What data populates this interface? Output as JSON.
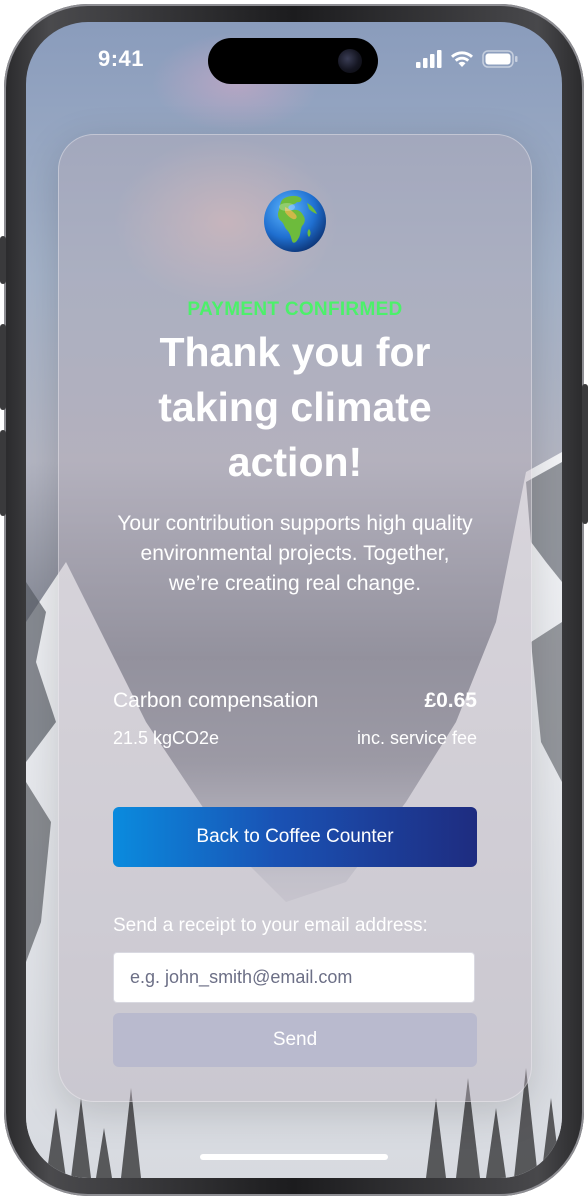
{
  "status_bar": {
    "time": "9:41"
  },
  "card": {
    "icon": "globe-europe-africa-icon",
    "status_label": "PAYMENT CONFIRMED",
    "status_color": "#4cf06a",
    "headline": "Thank you for taking climate action!",
    "subtext": "Your contribution supports high quality environmental projects. Together, we’re creating real change.",
    "summary": {
      "label": "Carbon compensation",
      "amount": "£0.65",
      "emissions": "21.5 kgCO2e",
      "fee_note": "inc. service fee"
    },
    "back_button_label": "Back to Coffee Counter",
    "receipt": {
      "label": "Send a receipt to your email address:",
      "placeholder": "e.g. john_smith@email.com",
      "send_label": "Send"
    }
  },
  "colors": {
    "button_gradient_start": "#0a8bde",
    "button_gradient_end": "#1e2c80",
    "send_button": "#b9bace"
  }
}
